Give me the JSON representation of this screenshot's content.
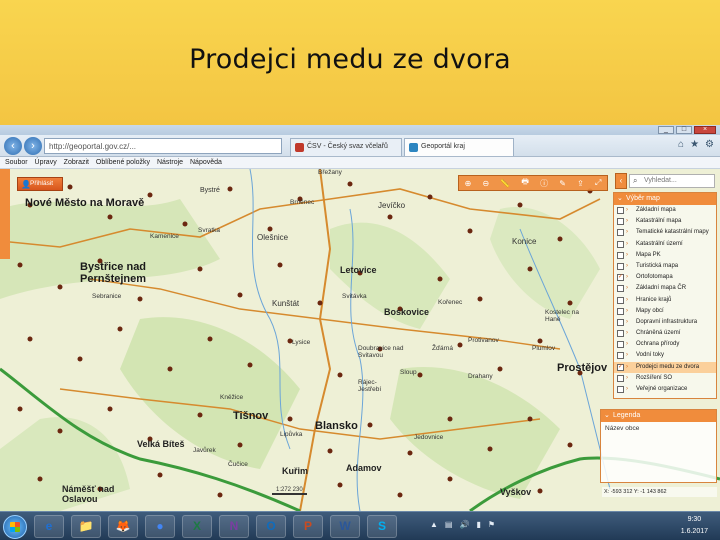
{
  "slide": {
    "title": "Prodejci medu ze dvora"
  },
  "browser": {
    "url": "http://geoportal.gov.cz/...",
    "tabs": [
      {
        "label": "ČSV - Český svaz včelařů",
        "active": false
      },
      {
        "label": "Geoportál kraj",
        "active": true
      }
    ],
    "menu": [
      "Soubor",
      "Úpravy",
      "Zobrazit",
      "Oblíbené položky",
      "Nástroje",
      "Nápověda"
    ]
  },
  "map": {
    "login_label": "Přihlásit",
    "search_placeholder": "Vyhledat...",
    "layers_title": "Výběr map",
    "layers": [
      {
        "label": "Základní mapa",
        "checked": false
      },
      {
        "label": "Katastrální mapa",
        "checked": false
      },
      {
        "label": "Tematické katastrální mapy",
        "checked": false
      },
      {
        "label": "Katastrální území",
        "checked": false
      },
      {
        "label": "Mapa PK",
        "checked": false
      },
      {
        "label": "Turistická mapa",
        "checked": false
      },
      {
        "label": "Ortofotomapa",
        "checked": true
      },
      {
        "label": "Základní mapa ČR",
        "checked": false
      },
      {
        "label": "Hranice krajů",
        "checked": false
      },
      {
        "label": "Mapy obcí",
        "checked": false
      },
      {
        "label": "Dopravní infrastruktura",
        "checked": false
      },
      {
        "label": "Chráněná území",
        "checked": false
      },
      {
        "label": "Ochrana přírody",
        "checked": false
      },
      {
        "label": "Vodní toky",
        "checked": false
      },
      {
        "label": "Prodejci medu ze dvora",
        "checked": true,
        "selected": true
      },
      {
        "label": "Rozšíření SO",
        "checked": false
      },
      {
        "label": "Veřejné organizace",
        "checked": false
      }
    ],
    "legend_title": "Legenda",
    "legend_text": "Název obce",
    "scale_label": "1:272 230",
    "coordinates": "X: -593 312  Y: -1 143 862",
    "accent_color": "#f08c3c",
    "places": [
      {
        "name": "Nové Město na Moravě",
        "kind": "big"
      },
      {
        "name": "Bystřice nad Pernštejnem",
        "kind": "big"
      },
      {
        "name": "Letovice",
        "kind": "town"
      },
      {
        "name": "Boskovice",
        "kind": "town"
      },
      {
        "name": "Tišnov",
        "kind": "big"
      },
      {
        "name": "Blansko",
        "kind": "big"
      },
      {
        "name": "Velká Bíteš",
        "kind": "town"
      },
      {
        "name": "Kuřim",
        "kind": "town"
      },
      {
        "name": "Adamov",
        "kind": "town"
      },
      {
        "name": "Vyškov",
        "kind": "town"
      },
      {
        "name": "Prostějov",
        "kind": "big"
      },
      {
        "name": "Náměšť nad Oslavou",
        "kind": "town"
      },
      {
        "name": "Konice",
        "kind": "town"
      },
      {
        "name": "Kostelec na Hané",
        "kind": "place"
      },
      {
        "name": "Plumlov",
        "kind": "place"
      },
      {
        "name": "Jedovnice",
        "kind": "place"
      },
      {
        "name": "Rájec-Jestřebí",
        "kind": "place"
      },
      {
        "name": "Kunštát",
        "kind": "place"
      },
      {
        "name": "Olešnice",
        "kind": "place"
      },
      {
        "name": "Svratka",
        "kind": "place"
      },
      {
        "name": "Lysice",
        "kind": "place"
      },
      {
        "name": "Kněžice",
        "kind": "place"
      },
      {
        "name": "Břežany",
        "kind": "place"
      },
      {
        "name": "Čučice",
        "kind": "place"
      },
      {
        "name": "Javůrek",
        "kind": "place"
      },
      {
        "name": "Sloup",
        "kind": "place"
      },
      {
        "name": "Drahany",
        "kind": "place"
      },
      {
        "name": "Protivanov",
        "kind": "place"
      },
      {
        "name": "Žďárná",
        "kind": "place"
      },
      {
        "name": "Doubravice nad Svitavou",
        "kind": "place"
      },
      {
        "name": "Lipůvka",
        "kind": "place"
      },
      {
        "name": "Svitávka",
        "kind": "place"
      },
      {
        "name": "Kořenec",
        "kind": "place"
      },
      {
        "name": "Jevíčko",
        "kind": "place"
      },
      {
        "name": "Brněnec",
        "kind": "place"
      },
      {
        "name": "Bystré",
        "kind": "place"
      },
      {
        "name": "Sebranice",
        "kind": "place"
      },
      {
        "name": "Kamenice",
        "kind": "place"
      }
    ]
  },
  "taskbar": {
    "apps": [
      "e",
      "📁",
      "🦊",
      "●",
      "X",
      "N",
      "O",
      "P",
      "W",
      "S"
    ],
    "time": "9:30",
    "date": "1.6.2017"
  }
}
